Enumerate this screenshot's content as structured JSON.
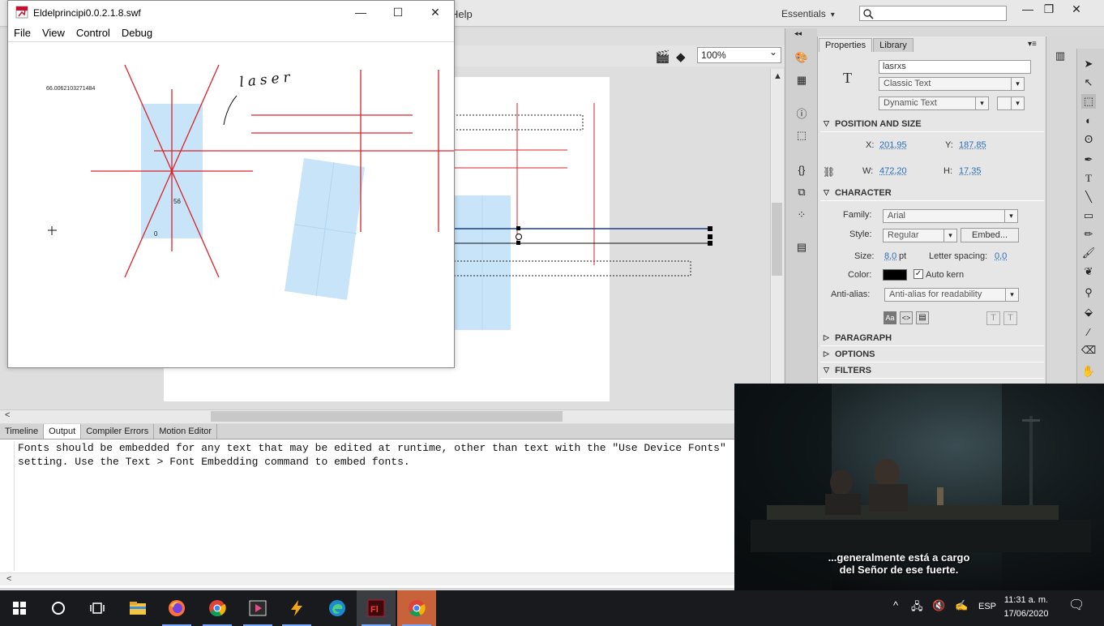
{
  "ide": {
    "menu_help": "Help",
    "workspace": "Essentials",
    "zoom": "100%",
    "window_controls": [
      "minimize",
      "maximize",
      "close"
    ]
  },
  "swf_window": {
    "title": "Eldelprincipi0.0.2.1.8.swf",
    "menu": [
      "File",
      "View",
      "Control",
      "Debug"
    ],
    "canvas_texts": {
      "number_readout": "66.0062103271484",
      "label_56": "56",
      "label_0": "0",
      "handwriting": "laser"
    }
  },
  "output_panel": {
    "tabs": [
      "Timeline",
      "Output",
      "Compiler Errors",
      "Motion Editor"
    ],
    "active_tab": "Output",
    "lines": [
      "Fonts should be embedded for any text that may be edited at runtime, other than text with the \"Use Device Fonts\"",
      "setting. Use the Text > Font Embedding command to embed fonts."
    ]
  },
  "properties": {
    "tabs": [
      "Properties",
      "Library"
    ],
    "instance_name": "lasrxs",
    "text_engine": "Classic Text",
    "text_type": "Dynamic Text",
    "position_size": {
      "title": "POSITION AND SIZE",
      "x_label": "X:",
      "x": "201,95",
      "y_label": "Y:",
      "y": "187,85",
      "w_label": "W:",
      "w": "472,20",
      "h_label": "H:",
      "h": "17,35"
    },
    "character": {
      "title": "CHARACTER",
      "family_label": "Family:",
      "family": "Arial",
      "style_label": "Style:",
      "style": "Regular",
      "embed_button": "Embed...",
      "size_label": "Size:",
      "size": "8,0",
      "size_unit": "pt",
      "spacing_label": "Letter spacing:",
      "spacing": "0,0",
      "color_label": "Color:",
      "color_value": "#000000",
      "autokern_label": "Auto kern",
      "antialias_label": "Anti-alias:",
      "antialias": "Anti-alias for readability"
    },
    "sections": [
      "PARAGRAPH",
      "OPTIONS",
      "FILTERS"
    ]
  },
  "video": {
    "subtitle_line1": "...generalmente está a cargo",
    "subtitle_line2": "del Señor de ese fuerte."
  },
  "taskbar": {
    "apps": [
      "start",
      "search",
      "task-view",
      "file-explorer",
      "firefox",
      "chrome",
      "video-editor",
      "winamp",
      "edge",
      "flash",
      "chrome-alt"
    ],
    "language": "ESP",
    "time": "11:31 a. m.",
    "date": "17/06/2020"
  },
  "colors": {
    "guide_red": "#d9232a",
    "shape_blue": "#c7e4f8",
    "selection_blue": "#1a3d8c",
    "link_blue": "#2a6ebb",
    "taskbar": "#181a1d"
  }
}
